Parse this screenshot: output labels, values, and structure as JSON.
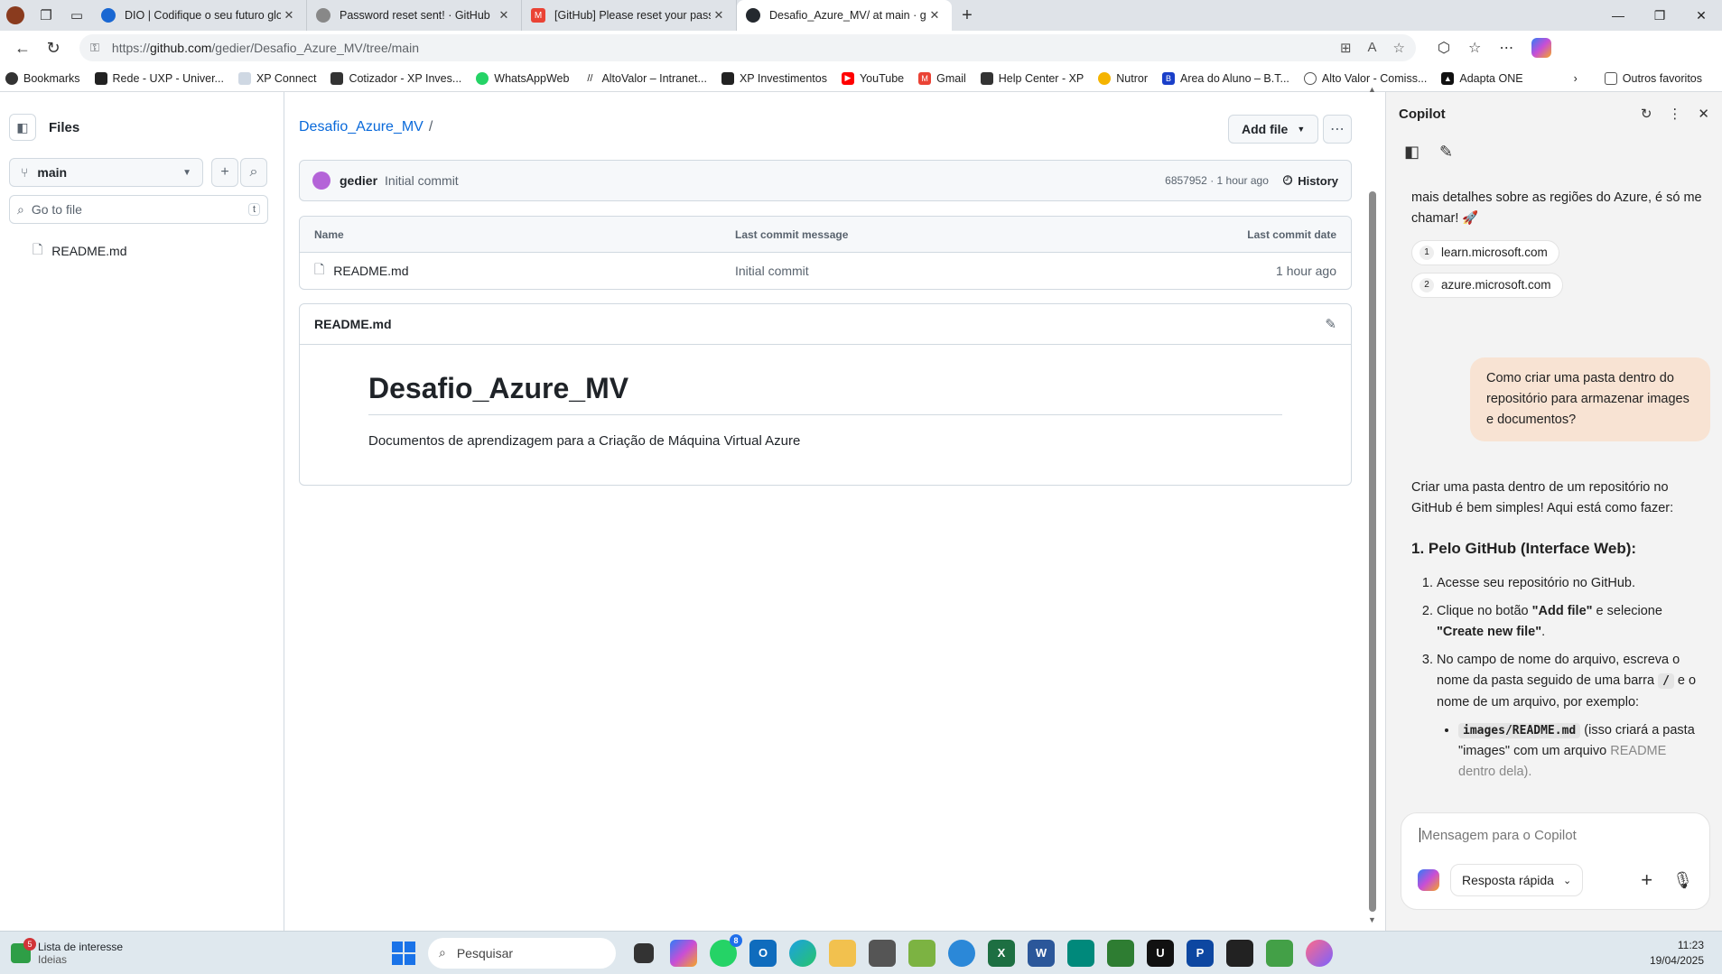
{
  "browser": {
    "tabs": [
      {
        "title": "DIO | Codifique o seu futuro glob",
        "color": "#1967d2"
      },
      {
        "title": "Password reset sent! · GitHub",
        "color": "#444444"
      },
      {
        "title": "[GitHub] Please reset your passwo",
        "color": "#ea4335"
      },
      {
        "title": "Desafio_Azure_MV/ at main · gedi",
        "color": "#24292f"
      }
    ],
    "url_scheme": "https://",
    "url_host": "github.com",
    "url_path": "/gedier/Desafio_Azure_MV/tree/main",
    "bookmarks": [
      "Bookmarks",
      "Rede - UXP - Univer...",
      "XP Connect",
      "Cotizador - XP Inves...",
      "WhatsAppWeb",
      "AltoValor – Intranet...",
      "XP Investimentos",
      "YouTube",
      "Gmail",
      "Help Center - XP",
      "Nutror",
      "Area do Aluno – B.T...",
      "Alto Valor - Comiss...",
      "Adapta ONE"
    ],
    "other_favorites": "Outros favoritos"
  },
  "github": {
    "files_title": "Files",
    "branch": "main",
    "goto_placeholder": "Go to file",
    "goto_shortcut": "t",
    "tree_items": [
      "README.md"
    ],
    "repo_name": "Desafio_Azure_MV",
    "breadcrumb_sep": "/",
    "add_file": "Add file",
    "commit": {
      "author": "gedier",
      "message": "Initial commit",
      "meta": "6857952 · 1 hour ago",
      "history": "History"
    },
    "table": {
      "col_name": "Name",
      "col_message": "Last commit message",
      "col_date": "Last commit date",
      "rows": [
        {
          "name": "README.md",
          "message": "Initial commit",
          "date": "1 hour ago"
        }
      ]
    },
    "readme": {
      "file_label": "README.md",
      "heading": "Desafio_Azure_MV",
      "body": "Documentos de aprendizagem para a Criação de Máquina Virtual Azure"
    }
  },
  "copilot": {
    "title": "Copilot",
    "partial_text": "mais detalhes sobre as regiões do Azure, é só me chamar! 🚀",
    "sources": [
      {
        "n": "1",
        "label": "learn.microsoft.com"
      },
      {
        "n": "2",
        "label": "azure.microsoft.com"
      }
    ],
    "user_message": "Como criar uma pasta dentro do repositório para armazenar images e documentos?",
    "answer_intro": "Criar uma pasta dentro de um repositório no GitHub é bem simples! Aqui está como fazer:",
    "answer_heading": "1. Pelo GitHub (Interface Web):",
    "step1": "Acesse seu repositório no GitHub.",
    "step2_a": "Clique no botão ",
    "step2_b": "\"Add file\"",
    "step2_c": " e selecione ",
    "step2_d": "\"Create new file\"",
    "step2_e": ".",
    "step3_a": "No campo de nome do arquivo, escreva o nome da pasta seguido de uma barra ",
    "step3_code": "/",
    "step3_b": " e o nome de um arquivo, por exemplo:",
    "bullet_code": "images/README.md",
    "bullet_text": " (isso criará a pasta \"images\" com um arquivo",
    "bullet_fade": "README dentro dela).",
    "input_placeholder": "Mensagem para o Copilot",
    "mode": "Resposta rápida"
  },
  "taskbar": {
    "news_title": "Lista de interesse",
    "news_sub": "Ideias",
    "news_badge": "5",
    "search": "Pesquisar",
    "whatsapp_badge": "8",
    "time": "11:23",
    "date": "19/04/2025"
  }
}
